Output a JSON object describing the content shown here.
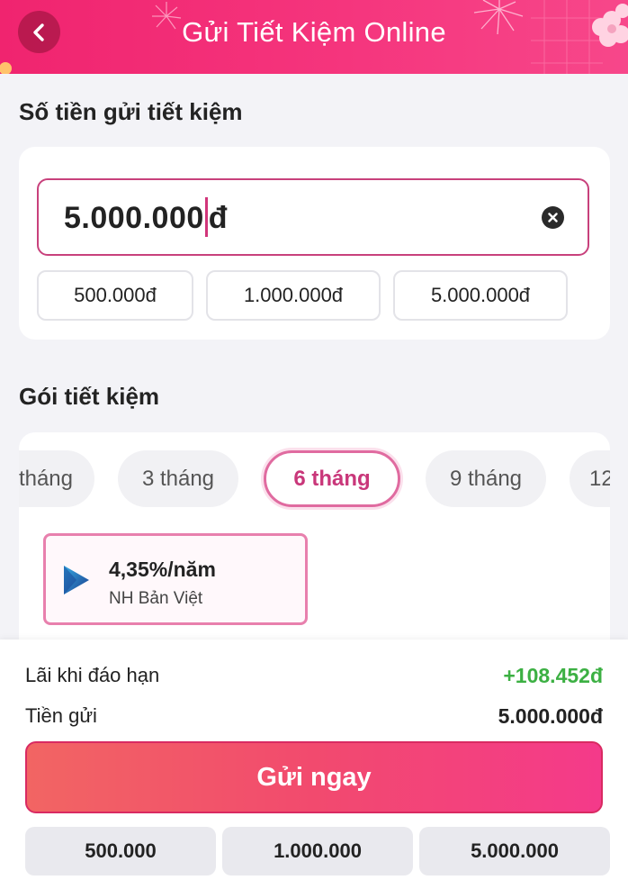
{
  "header": {
    "title": "Gửi Tiết Kiệm Online",
    "back_icon": "chevron-left-icon"
  },
  "amount_section": {
    "title": "Số tiền gửi tiết kiệm",
    "input_value": "5.000.000",
    "input_suffix": "đ",
    "clear_icon": "close-circle-icon",
    "chips": [
      "500.000đ",
      "1.000.000đ",
      "5.000.000đ"
    ]
  },
  "package_section": {
    "title": "Gói tiết kiệm",
    "terms": [
      "tháng",
      "3 tháng",
      "6 tháng",
      "9 tháng",
      "12"
    ],
    "selected_term": "6 tháng",
    "offer": {
      "rate": "4,35%/năm",
      "bank": "NH Bản Việt",
      "logo_icon": "play-triangle-logo-icon"
    }
  },
  "summary": {
    "interest_label": "Lãi khi đáo hạn",
    "interest_value": "+108.452đ",
    "deposit_label": "Tiền gửi",
    "deposit_value": "5.000.000đ",
    "submit_label": "Gửi ngay",
    "quick_amounts": [
      "500.000",
      "1.000.000",
      "5.000.000"
    ]
  },
  "colors": {
    "brand": "#f0246f",
    "accent": "#c9377a",
    "positive": "#3cb043"
  }
}
